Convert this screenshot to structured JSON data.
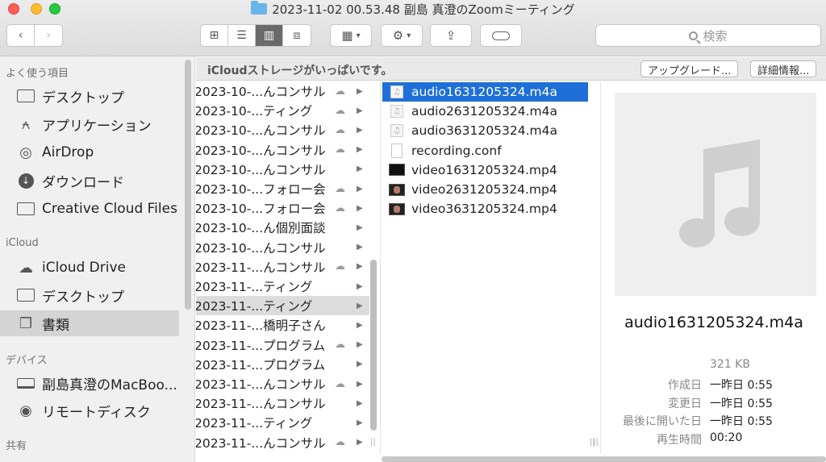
{
  "window": {
    "title": "2023-11-02 00.53.48 副島 真澄のZoomミーティング"
  },
  "toolbar": {
    "back_icon": "chevron-left-icon",
    "forward_icon": "chevron-right-icon",
    "view_modes": [
      "icon-view-icon",
      "list-view-icon",
      "column-view-icon",
      "gallery-view-icon"
    ],
    "selected_view": "column-view-icon",
    "search_placeholder": "検索"
  },
  "sidebar": {
    "favorites_heading": "よく使う項目",
    "favorites": [
      {
        "label": "デスクトップ",
        "icon": "desktop-icon"
      },
      {
        "label": "アプリケーション",
        "icon": "applications-icon"
      },
      {
        "label": "AirDrop",
        "icon": "airdrop-icon"
      },
      {
        "label": "ダウンロード",
        "icon": "download-icon"
      },
      {
        "label": "Creative Cloud Files",
        "icon": "folder-icon"
      }
    ],
    "icloud_heading": "iCloud",
    "icloud": [
      {
        "label": "iCloud Drive",
        "icon": "cloud-icon"
      },
      {
        "label": "デスクトップ",
        "icon": "desktop-icon"
      },
      {
        "label": "書類",
        "icon": "documents-icon"
      }
    ],
    "devices_heading": "デバイス",
    "devices": [
      {
        "label": "副島真澄のMacBoo...",
        "icon": "laptop-icon"
      },
      {
        "label": "リモートディスク",
        "icon": "disc-icon"
      }
    ],
    "shared_heading": "共有"
  },
  "banner": {
    "text": "iCloudストレージがいっぱいです。",
    "upgrade_label": "アップグレード...",
    "details_label": "詳細情報..."
  },
  "column1": {
    "items": [
      {
        "name": "2023-10-...んコンサル",
        "cloud": "cloud-download-icon"
      },
      {
        "name": "2023-10-...ティング",
        "cloud": "cloud-download-icon"
      },
      {
        "name": "2023-10-...んコンサル",
        "cloud": "cloud-download-icon"
      },
      {
        "name": "2023-10-...んコンサル",
        "cloud": "cloud-download-icon"
      },
      {
        "name": "2023-10-...んコンサル",
        "cloud": ""
      },
      {
        "name": "2023-10-...フォロー会",
        "cloud": "cloud-warning-icon"
      },
      {
        "name": "2023-10-...フォロー会",
        "cloud": "cloud-warning-icon"
      },
      {
        "name": "2023-10-...ん個別面談",
        "cloud": ""
      },
      {
        "name": "2023-10-...んコンサル",
        "cloud": ""
      },
      {
        "name": "2023-11-...んコンサル",
        "cloud": "cloud-warning-icon"
      },
      {
        "name": "2023-11-...ティング",
        "cloud": ""
      },
      {
        "name": "2023-11-...ティング",
        "cloud": ""
      },
      {
        "name": "2023-11-...橋明子さん",
        "cloud": ""
      },
      {
        "name": "2023-11-...プログラム",
        "cloud": "cloud-warning-icon"
      },
      {
        "name": "2023-11-...プログラム",
        "cloud": ""
      },
      {
        "name": "2023-11-...んコンサル",
        "cloud": "cloud-warning-icon"
      },
      {
        "name": "2023-11-...んコンサル",
        "cloud": ""
      },
      {
        "name": "2023-11-...ティング",
        "cloud": ""
      },
      {
        "name": "2023-11-...んコンサル",
        "cloud": "cloud-warning-icon"
      }
    ],
    "selected_index": 11
  },
  "column2": {
    "files": [
      {
        "name": "audio1631205324.m4a",
        "type": "audio"
      },
      {
        "name": "audio2631205324.m4a",
        "type": "audio"
      },
      {
        "name": "audio3631205324.m4a",
        "type": "audio"
      },
      {
        "name": "recording.conf",
        "type": "doc"
      },
      {
        "name": "video1631205324.mp4",
        "type": "video"
      },
      {
        "name": "video2631205324.mp4",
        "type": "video2"
      },
      {
        "name": "video3631205324.mp4",
        "type": "video2"
      }
    ],
    "selected_index": 0
  },
  "preview": {
    "thumbnail_icon": "music-note-icon",
    "filename": "audio1631205324.m4a",
    "size": "321 KB",
    "meta": [
      {
        "key": "作成日",
        "value": "一昨日 0:55"
      },
      {
        "key": "変更日",
        "value": "一昨日 0:55"
      },
      {
        "key": "最後に開いた日",
        "value": "一昨日 0:55"
      },
      {
        "key": "再生時間",
        "value": "00:20"
      }
    ]
  }
}
